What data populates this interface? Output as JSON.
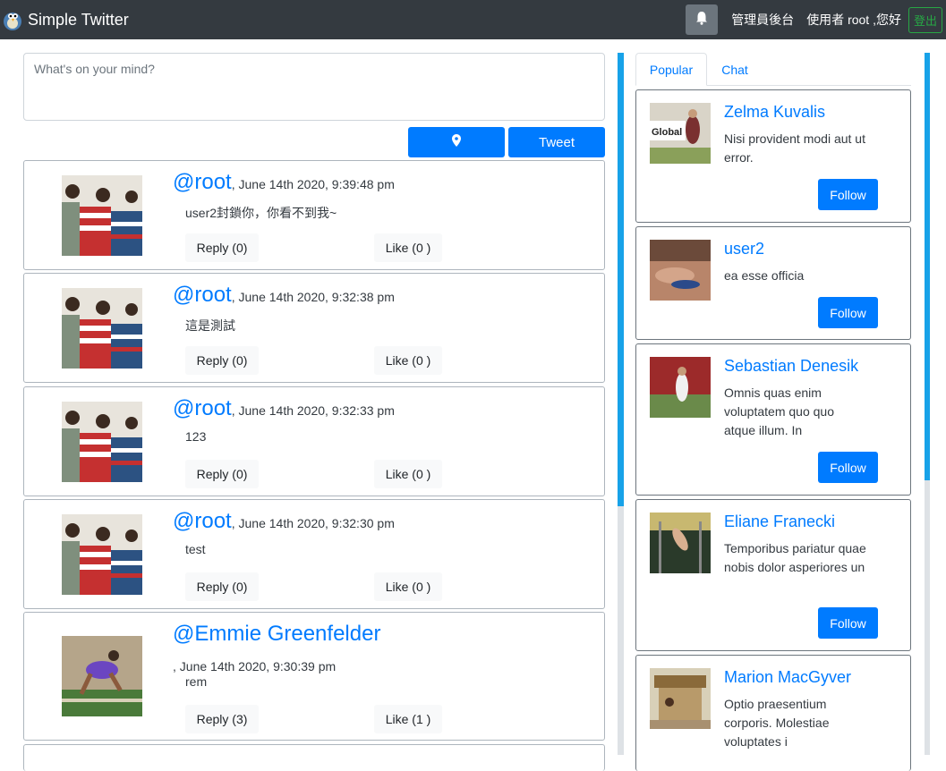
{
  "nav": {
    "brand": "Simple Twitter",
    "admin_link": "管理員後台",
    "greeting": "使用者 root ,您好",
    "logout": "登出"
  },
  "compose": {
    "placeholder": "What's on your mind?",
    "tweet_label": "Tweet"
  },
  "tweets": [
    {
      "handle": "@root",
      "time": ", June 14th 2020, 9:39:48 pm",
      "text": "user2封鎖你，你看不到我~",
      "reply": "Reply (0)",
      "like": "Like (0 )"
    },
    {
      "handle": "@root",
      "time": ", June 14th 2020, 9:32:38 pm",
      "text": "這是測試",
      "reply": "Reply (0)",
      "like": "Like (0 )"
    },
    {
      "handle": "@root",
      "time": ", June 14th 2020, 9:32:33 pm",
      "text": "123",
      "reply": "Reply (0)",
      "like": "Like (0 )"
    },
    {
      "handle": "@root",
      "time": ", June 14th 2020, 9:32:30 pm",
      "text": "test",
      "reply": "Reply (0)",
      "like": "Like (0 )"
    },
    {
      "handle": "@Emmie Greenfelder",
      "time": ", June 14th 2020, 9:30:39 pm",
      "text": "rem",
      "reply": "Reply (3)",
      "like": "Like (1 )"
    }
  ],
  "tabs": [
    "Popular",
    "Chat"
  ],
  "popular_users": [
    {
      "name": "Zelma Kuvalis",
      "desc": "Nisi provident modi aut ut error.",
      "follow": "Follow"
    },
    {
      "name": "user2",
      "desc": "ea esse officia",
      "follow": "Follow"
    },
    {
      "name": "Sebastian Denesik",
      "desc": "Omnis quas enim voluptatem quo quo atque illum. In",
      "follow": "Follow"
    },
    {
      "name": "Eliane Franecki",
      "desc": "Temporibus pariatur quae nobis dolor asperiores un",
      "follow": "Follow"
    },
    {
      "name": "Marion MacGyver",
      "desc": "Optio praesentium corporis. Molestiae voluptates i",
      "follow": "Follow"
    }
  ],
  "colors": {
    "primary": "#007bff",
    "navbar": "#343a40",
    "logout": "#28a745",
    "scrollbar": "#17a2e8"
  },
  "icons": {
    "brand": "bird-logo-icon",
    "bell": "bell-icon",
    "location": "map-marker-icon"
  }
}
